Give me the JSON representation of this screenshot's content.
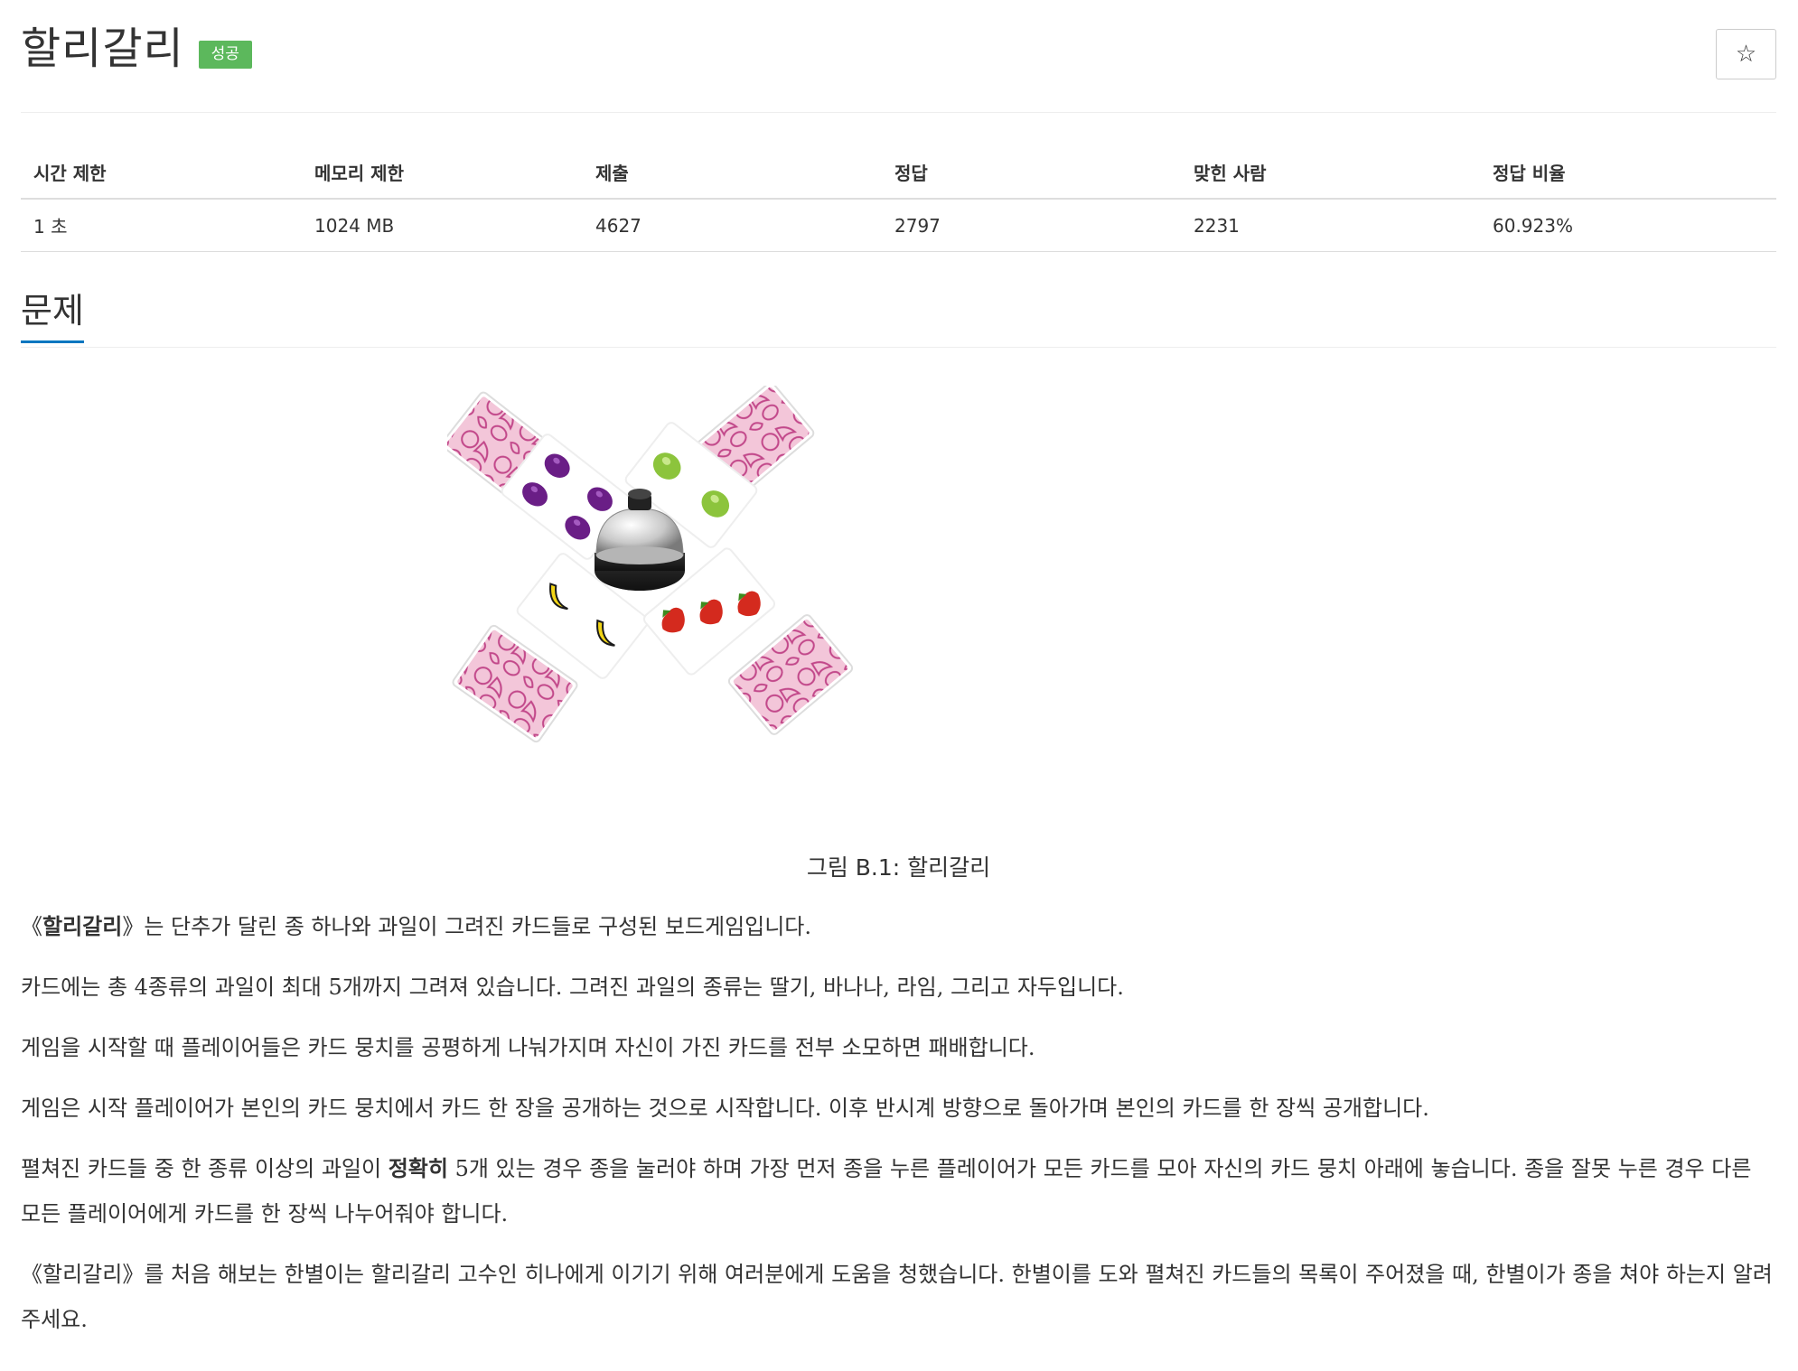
{
  "problem": {
    "title": "할리갈리",
    "status_badge": "성공",
    "favorite_icon": "star-icon",
    "favorite_glyph": "☆"
  },
  "stats": {
    "headers": [
      "시간 제한",
      "메모리 제한",
      "제출",
      "정답",
      "맞힌 사람",
      "정답 비율"
    ],
    "values": [
      "1 초",
      "1024 MB",
      "4627",
      "2797",
      "2231",
      "60.923%"
    ]
  },
  "section": {
    "heading": "문제",
    "figure_caption": "그림 B.1: 할리갈리",
    "paragraphs": {
      "p1_pre": "《",
      "p1_bold": "할리갈리",
      "p1_post": "》는 단추가 달린 종 하나와 과일이 그려진 카드들로 구성된 보드게임입니다.",
      "p2": "카드에는 총 4종류의 과일이 최대 5개까지 그려져 있습니다. 그려진 과일의 종류는 딸기, 바나나, 라임, 그리고 자두입니다.",
      "p3": "게임을 시작할 때 플레이어들은 카드 뭉치를 공평하게 나눠가지며 자신이 가진 카드를 전부 소모하면 패배합니다.",
      "p4": "게임은 시작 플레이어가 본인의 카드 뭉치에서 카드 한 장을 공개하는 것으로 시작합니다. 이후 반시계 방향으로 돌아가며 본인의 카드를 한 장씩 공개합니다.",
      "p5_pre": "펼쳐진 카드들 중 한 종류 이상의 과일이 ",
      "p5_bold": "정확히",
      "p5_post": " 5개 있는 경우 종을 눌러야 하며 가장 먼저 종을 누른 플레이어가 모든 카드를 모아 자신의 카드 뭉치 아래에 놓습니다. 종을 잘못 누른 경우 다른 모든 플레이어에게 카드를 한 장씩 나누어줘야 합니다.",
      "p6": "《할리갈리》를 처음 해보는 한별이는 할리갈리 고수인 히나에게 이기기 위해 여러분에게 도움을 청했습니다. 한별이를 도와 펼쳐진 카드들의 목록이 주어졌을 때, 한별이가 종을 쳐야 하는지 알려주세요."
    }
  },
  "figure": {
    "colors": {
      "card_back": "#f3c6d9",
      "card_pattern": "#c2488a",
      "plum": "#6a1e86",
      "lime": "#8cc43c",
      "banana": "#f2d515",
      "strawberry": "#d42a1e",
      "bell_base": "#222222",
      "bell_dome": "#d8d8d8"
    },
    "cards": [
      {
        "fruit": "plum",
        "count": 4
      },
      {
        "fruit": "lime",
        "count": 2
      },
      {
        "fruit": "banana",
        "count": 2
      },
      {
        "fruit": "strawberry",
        "count": 3
      }
    ]
  }
}
